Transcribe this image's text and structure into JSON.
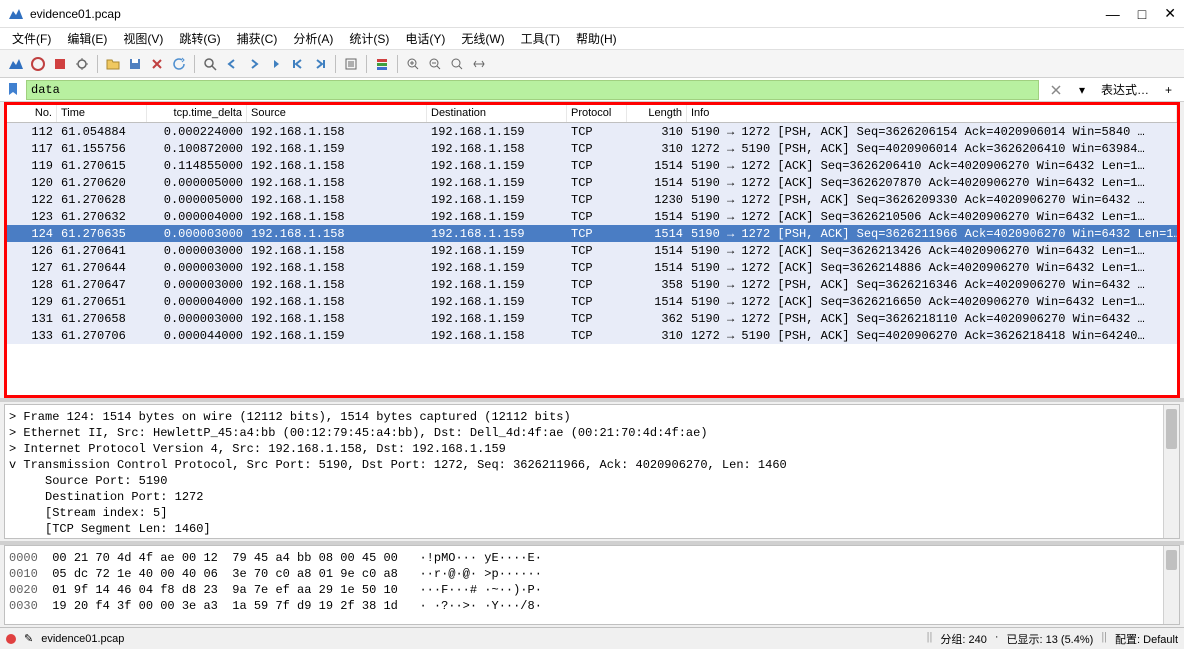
{
  "window": {
    "title": "evidence01.pcap",
    "min": "—",
    "max": "□",
    "close": "✕"
  },
  "menu": {
    "file": "文件(F)",
    "edit": "编辑(E)",
    "view": "视图(V)",
    "go": "跳转(G)",
    "capture": "捕获(C)",
    "analyze": "分析(A)",
    "statistics": "统计(S)",
    "telephony": "电话(Y)",
    "wireless": "无线(W)",
    "tools": "工具(T)",
    "help": "帮助(H)"
  },
  "filter": {
    "value": "data",
    "expression": "表达式…",
    "plus": "+"
  },
  "columns": {
    "no": "No.",
    "time": "Time",
    "delta": "tcp.time_delta",
    "source": "Source",
    "destination": "Destination",
    "protocol": "Protocol",
    "length": "Length",
    "info": "Info"
  },
  "packets": [
    {
      "no": "112",
      "time": "61.054884",
      "delta": "0.000224000",
      "src": "192.168.1.158",
      "dst": "192.168.1.159",
      "proto": "TCP",
      "len": "310",
      "info": "5190 → 1272 [PSH, ACK] Seq=3626206154 Ack=4020906014 Win=5840 …"
    },
    {
      "no": "117",
      "time": "61.155756",
      "delta": "0.100872000",
      "src": "192.168.1.159",
      "dst": "192.168.1.158",
      "proto": "TCP",
      "len": "310",
      "info": "1272 → 5190 [PSH, ACK] Seq=4020906014 Ack=3626206410 Win=63984…"
    },
    {
      "no": "119",
      "time": "61.270615",
      "delta": "0.114855000",
      "src": "192.168.1.158",
      "dst": "192.168.1.159",
      "proto": "TCP",
      "len": "1514",
      "info": "5190 → 1272 [ACK] Seq=3626206410 Ack=4020906270 Win=6432 Len=1…"
    },
    {
      "no": "120",
      "time": "61.270620",
      "delta": "0.000005000",
      "src": "192.168.1.158",
      "dst": "192.168.1.159",
      "proto": "TCP",
      "len": "1514",
      "info": "5190 → 1272 [ACK] Seq=3626207870 Ack=4020906270 Win=6432 Len=1…"
    },
    {
      "no": "122",
      "time": "61.270628",
      "delta": "0.000005000",
      "src": "192.168.1.158",
      "dst": "192.168.1.159",
      "proto": "TCP",
      "len": "1230",
      "info": "5190 → 1272 [PSH, ACK] Seq=3626209330 Ack=4020906270 Win=6432 …"
    },
    {
      "no": "123",
      "time": "61.270632",
      "delta": "0.000004000",
      "src": "192.168.1.158",
      "dst": "192.168.1.159",
      "proto": "TCP",
      "len": "1514",
      "info": "5190 → 1272 [ACK] Seq=3626210506 Ack=4020906270 Win=6432 Len=1…"
    },
    {
      "no": "124",
      "time": "61.270635",
      "delta": "0.000003000",
      "src": "192.168.1.158",
      "dst": "192.168.1.159",
      "proto": "TCP",
      "len": "1514",
      "info": "5190 → 1272 [PSH, ACK] Seq=3626211966 Ack=4020906270 Win=6432 Len=1…",
      "sel": true
    },
    {
      "no": "126",
      "time": "61.270641",
      "delta": "0.000003000",
      "src": "192.168.1.158",
      "dst": "192.168.1.159",
      "proto": "TCP",
      "len": "1514",
      "info": "5190 → 1272 [ACK] Seq=3626213426 Ack=4020906270 Win=6432 Len=1…"
    },
    {
      "no": "127",
      "time": "61.270644",
      "delta": "0.000003000",
      "src": "192.168.1.158",
      "dst": "192.168.1.159",
      "proto": "TCP",
      "len": "1514",
      "info": "5190 → 1272 [ACK] Seq=3626214886 Ack=4020906270 Win=6432 Len=1…"
    },
    {
      "no": "128",
      "time": "61.270647",
      "delta": "0.000003000",
      "src": "192.168.1.158",
      "dst": "192.168.1.159",
      "proto": "TCP",
      "len": "358",
      "info": "5190 → 1272 [PSH, ACK] Seq=3626216346 Ack=4020906270 Win=6432 …"
    },
    {
      "no": "129",
      "time": "61.270651",
      "delta": "0.000004000",
      "src": "192.168.1.158",
      "dst": "192.168.1.159",
      "proto": "TCP",
      "len": "1514",
      "info": "5190 → 1272 [ACK] Seq=3626216650 Ack=4020906270 Win=6432 Len=1…"
    },
    {
      "no": "131",
      "time": "61.270658",
      "delta": "0.000003000",
      "src": "192.168.1.158",
      "dst": "192.168.1.159",
      "proto": "TCP",
      "len": "362",
      "info": "5190 → 1272 [PSH, ACK] Seq=3626218110 Ack=4020906270 Win=6432 …"
    },
    {
      "no": "133",
      "time": "61.270706",
      "delta": "0.000044000",
      "src": "192.168.1.159",
      "dst": "192.168.1.158",
      "proto": "TCP",
      "len": "310",
      "info": "1272 → 5190 [PSH, ACK] Seq=4020906270 Ack=3626218418 Win=64240…"
    }
  ],
  "details": [
    {
      "exp": ">",
      "text": "Frame 124: 1514 bytes on wire (12112 bits), 1514 bytes captured (12112 bits)"
    },
    {
      "exp": ">",
      "text": "Ethernet II, Src: HewlettP_45:a4:bb (00:12:79:45:a4:bb), Dst: Dell_4d:4f:ae (00:21:70:4d:4f:ae)"
    },
    {
      "exp": ">",
      "text": "Internet Protocol Version 4, Src: 192.168.1.158, Dst: 192.168.1.159"
    },
    {
      "exp": "v",
      "text": "Transmission Control Protocol, Src Port: 5190, Dst Port: 1272, Seq: 3626211966, Ack: 4020906270, Len: 1460"
    },
    {
      "exp": " ",
      "text": "   Source Port: 5190"
    },
    {
      "exp": " ",
      "text": "   Destination Port: 1272"
    },
    {
      "exp": " ",
      "text": "   [Stream index: 5]"
    },
    {
      "exp": " ",
      "text": "   [TCP Segment Len: 1460]"
    }
  ],
  "hex": [
    {
      "off": "0000",
      "bytes": "00 21 70 4d 4f ae 00 12  79 45 a4 bb 08 00 45 00",
      "ascii": "·!pMO··· yE····E·"
    },
    {
      "off": "0010",
      "bytes": "05 dc 72 1e 40 00 40 06  3e 70 c0 a8 01 9e c0 a8",
      "ascii": "··r·@·@· >p······"
    },
    {
      "off": "0020",
      "bytes": "01 9f 14 46 04 f8 d8 23  9a 7e ef aa 29 1e 50 10",
      "ascii": "···F···# ·~··)·P·"
    },
    {
      "off": "0030",
      "bytes": "19 20 f4 3f 00 00 3e a3  1a 59 7f d9 19 2f 38 1d",
      "ascii": "· ·?··>· ·Y···/8·"
    }
  ],
  "status": {
    "file": "evidence01.pcap",
    "packets": "分组: 240",
    "displayed": "已显示: 13 (5.4%)",
    "profile": "配置: Default"
  }
}
